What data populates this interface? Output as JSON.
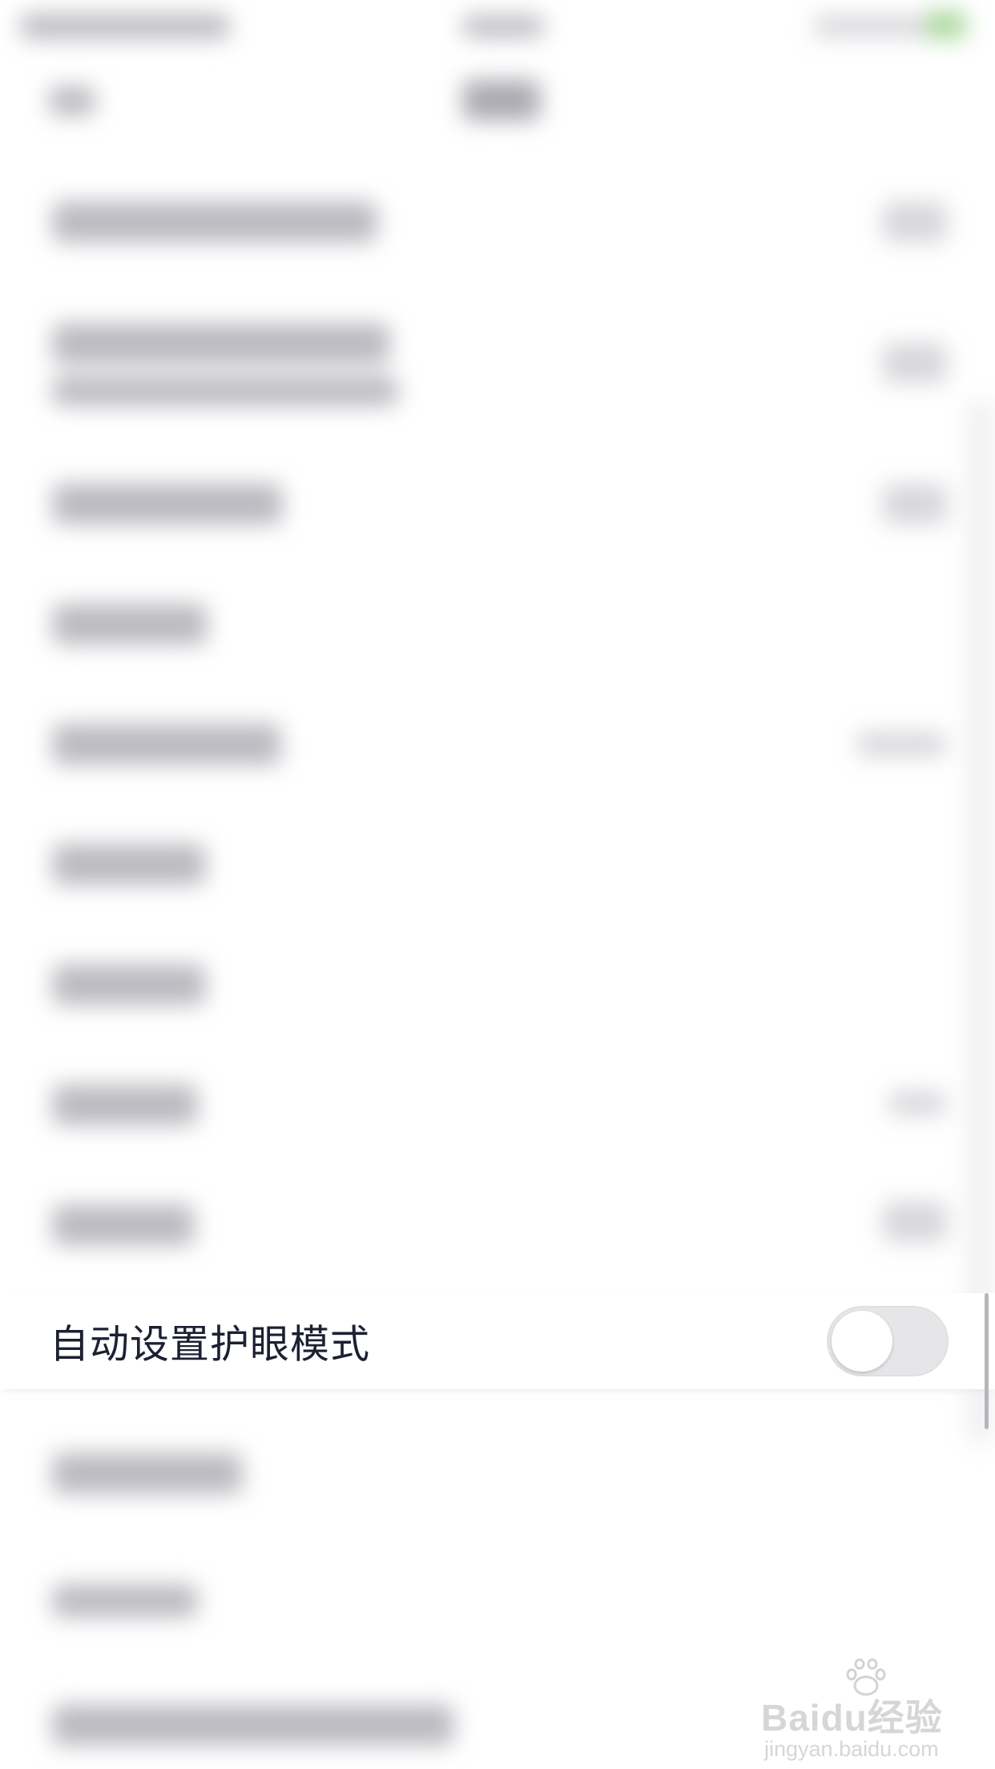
{
  "settings": {
    "focused_item": {
      "label": "自动设置护眼模式",
      "toggle_on": false
    }
  },
  "watermark": {
    "logo": "Baidu经验",
    "url": "jingyan.baidu.com"
  },
  "colors": {
    "toggle_off_track": "#e6e6e8",
    "toggle_knob": "#ffffff",
    "label_text": "#1c2033",
    "status_green": "#a8d79a"
  }
}
